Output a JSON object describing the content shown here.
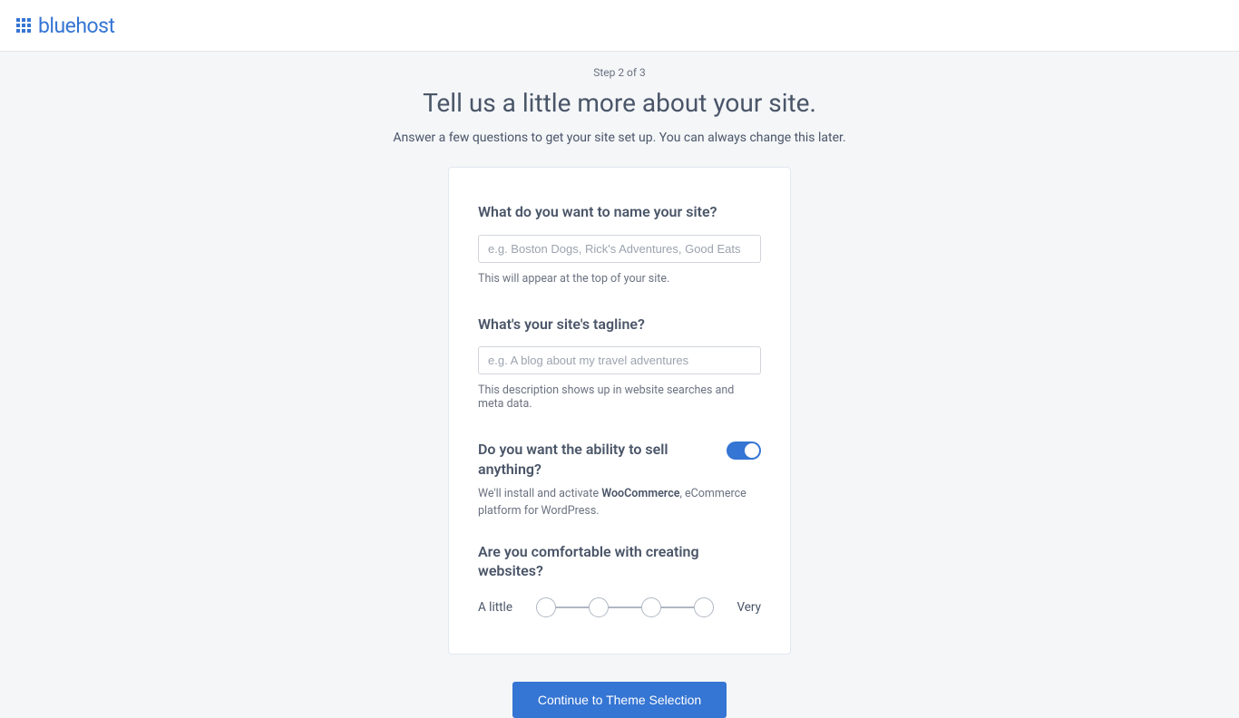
{
  "brand": "bluehost",
  "step_label": "Step 2 of 3",
  "page_title": "Tell us a little more about your site.",
  "page_subtitle": "Answer a few questions to get your site set up. You can always change this later.",
  "form": {
    "site_name": {
      "label": "What do you want to name your site?",
      "placeholder": "e.g. Boston Dogs, Rick's Adventures, Good Eats",
      "helper": "This will appear at the top of your site."
    },
    "tagline": {
      "label": "What's your site's tagline?",
      "placeholder": "e.g. A blog about my travel adventures",
      "helper": "This description shows up in website searches and meta data."
    },
    "sell": {
      "label": "Do you want the ability to sell anything?",
      "helper_prefix": "We'll install and activate ",
      "helper_strong": "WooCommerce",
      "helper_suffix": ", eCommerce platform for WordPress.",
      "enabled": true
    },
    "comfort": {
      "label": "Are you comfortable with creating websites?",
      "min_label": "A little",
      "max_label": "Very"
    }
  },
  "continue_button": "Continue to Theme Selection"
}
